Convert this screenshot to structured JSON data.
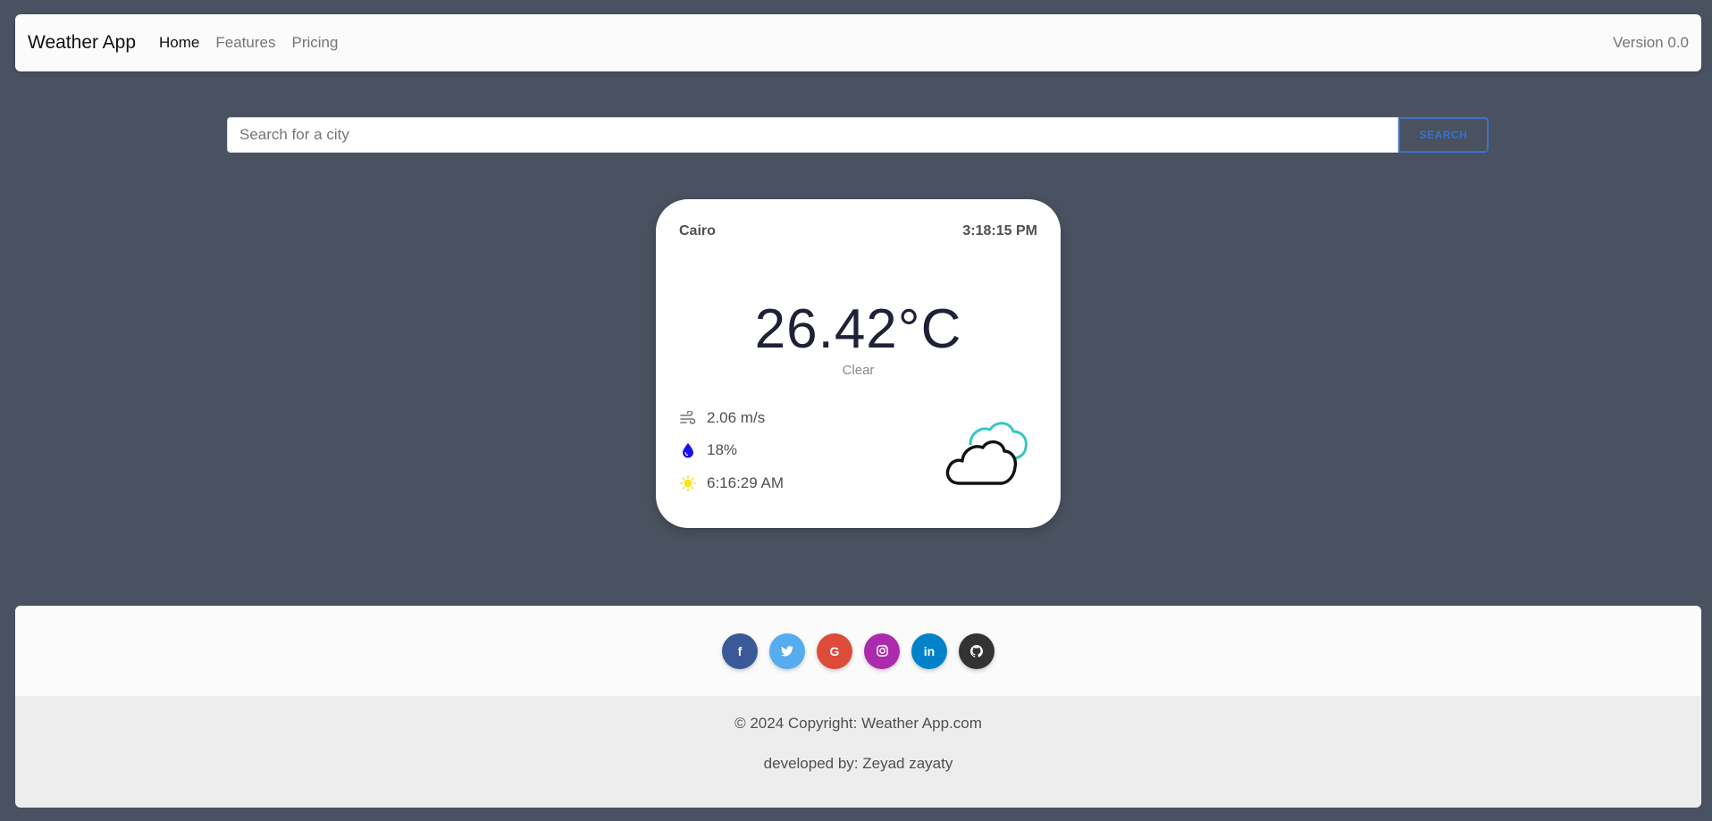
{
  "navbar": {
    "brand": "Weather App",
    "links": [
      {
        "label": "Home",
        "active": true
      },
      {
        "label": "Features",
        "active": false
      },
      {
        "label": "Pricing",
        "active": false
      }
    ],
    "version": "Version 0.0"
  },
  "search": {
    "placeholder": "Search for a city",
    "value": "",
    "button_label": "SEARCH"
  },
  "weather": {
    "city": "Cairo",
    "time": "3:18:15 PM",
    "temperature": "26.42°C",
    "description": "Clear",
    "wind": "2.06 m/s",
    "humidity": "18%",
    "sunrise": "6:16:29 AM",
    "icon": "partly-cloudy-icon"
  },
  "footer": {
    "social": [
      {
        "name": "facebook",
        "glyph": "f",
        "color": "#3b5998"
      },
      {
        "name": "twitter",
        "glyph": "t",
        "color": "#55acee"
      },
      {
        "name": "google",
        "glyph": "G",
        "color": "#dd4b39"
      },
      {
        "name": "instagram",
        "glyph": "◎",
        "color": "#ac2bac"
      },
      {
        "name": "linkedin",
        "glyph": "in",
        "color": "#0082ca"
      },
      {
        "name": "github",
        "glyph": "●",
        "color": "#333333"
      }
    ],
    "copyright_prefix": "© 2024 Copyright: ",
    "copyright_link": "Weather App.com",
    "developer": "developed by: Zeyad zayaty"
  },
  "colors": {
    "background": "#4a5160",
    "accent": "#3b71ca"
  }
}
